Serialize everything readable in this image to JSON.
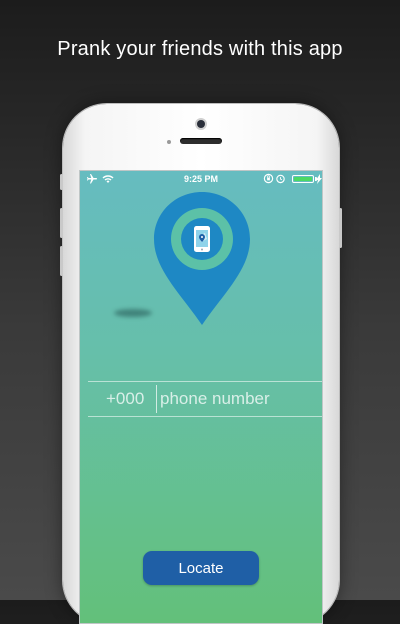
{
  "headline": "Prank your friends with this app",
  "status_bar": {
    "time": "9:25 PM",
    "left_icons": [
      "airplane-icon",
      "wifi-icon"
    ],
    "right_icons": [
      "rotation-lock-icon",
      "alarm-icon",
      "battery-icon",
      "charging-icon"
    ],
    "battery_level": 1.0
  },
  "hero": {
    "icon": "map-pin-phone-icon",
    "colors": {
      "pin": "#1e88c4",
      "ring": "#5cc1a7",
      "inner": "#1e88c4"
    }
  },
  "phone_form": {
    "country_code": "+000",
    "placeholder": "phone number"
  },
  "locate_button": {
    "label": "Locate"
  },
  "colors": {
    "screen_top": "#66bcc0",
    "screen_bottom": "#63c07a",
    "button": "#1f5fa6",
    "battery": "#4cd964"
  }
}
